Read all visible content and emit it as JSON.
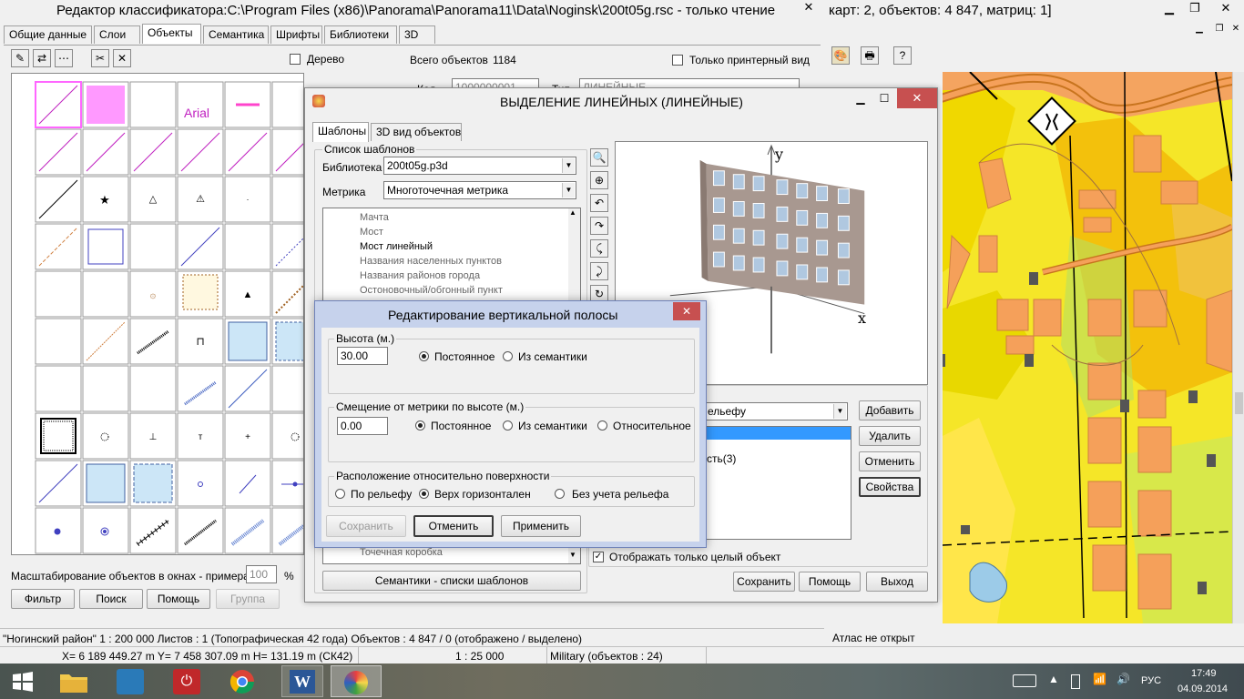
{
  "main": {
    "title": "Редактор классификатора:C:\\Program Files (x86)\\Panorama\\Panorama11\\Data\\Noginsk\\200t05g.rsc - только чтение",
    "tabs": [
      "Общие данные",
      "Слои",
      "Объекты",
      "Семантика",
      "Шрифты",
      "Библиотеки",
      "3D"
    ],
    "tree_checkbox": "Дерево",
    "total_label": "Всего объектов",
    "total_value": "1184",
    "printer_checkbox": "Только принтерный вид",
    "code_label": "Код",
    "code_value": "1000000001",
    "type_label": "Тип",
    "type_value": "ЛИНЕЙНЫЕ",
    "scale_label": "Масштабирование объектов в окнах - примерах",
    "scale_value": "100",
    "scale_unit": "%",
    "buttons": {
      "filter": "Фильтр",
      "search": "Поиск",
      "help": "Помощь",
      "group": "Группа"
    }
  },
  "map_window": {
    "title_tail": "карт: 2, объектов: 4 847, матриц: 1]",
    "atlas": "Атлас не открыт"
  },
  "dialog3d": {
    "title": "ВЫДЕЛЕНИЕ ЛИНЕЙНЫХ (ЛИНЕЙНЫЕ)",
    "tabs": [
      "Шаблоны",
      "3D вид объектов"
    ],
    "group_label": "Список шаблонов",
    "library_label": "Библиотека",
    "library_value": "200t05g.p3d",
    "metric_label": "Метрика",
    "metric_value": "Многоточечная метрика",
    "tree_items": [
      "Мачта",
      "Мост",
      "Мост линейный",
      "Названия населенных пунктов",
      "Названия районов города",
      "Остоновочный/обгонный пункт"
    ],
    "tree_bottom": "Точечная коробка",
    "semantics_button": "Семантики - списки шаблонов",
    "axis_y": "y",
    "axis_x": "x",
    "relief_combo": "ельефу",
    "list_item": "сть(3)",
    "right_buttons": {
      "add": "Добавить",
      "delete": "Удалить",
      "cancel": "Отменить",
      "props": "Свойства"
    },
    "only_whole": "Отображать только целый объект",
    "bottom_buttons": {
      "save": "Сохранить",
      "help": "Помощь",
      "exit": "Выход"
    }
  },
  "dialog_vert": {
    "title": "Редактирование вертикальной полосы",
    "height_group": "Высота (м.)",
    "height_value": "30.00",
    "opt_const": "Постоянное",
    "opt_sem": "Из семантики",
    "offset_group": "Смещение от метрики по высоте (м.)",
    "offset_value": "0.00",
    "opt_rel": "Относительное",
    "surface_group": "Расположение относительно поверхности",
    "opt_relief": "По рельефу",
    "opt_top": "Верх горизонтален",
    "opt_norelief": "Без учета рельефа",
    "buttons": {
      "save": "Сохранить",
      "cancel": "Отменить",
      "apply": "Применить"
    },
    "close": "✕"
  },
  "status": {
    "line1": "\"Ногинский район\"  1 : 200 000  Листов : 1   (Топографическая 42 года)  Объектов : 4 847 / 0 (отображено / выделено)",
    "coords": "X= 6 189 449.27 m  Y= 7 458 307.09 m  H=  131.19 m  (СК42)",
    "scale": "1 : 25 000",
    "military": "Military   (объектов : 24)"
  },
  "taskbar": {
    "lang": "РУС",
    "time": "17:49",
    "date": "04.09.2014"
  },
  "cell_labels": {
    "arial": "Arial"
  },
  "colors": {
    "selection_blue": "#3399ff",
    "map_yellow": "#ffe600",
    "map_orange": "#f5a05a",
    "pink": "#ff99ff"
  }
}
